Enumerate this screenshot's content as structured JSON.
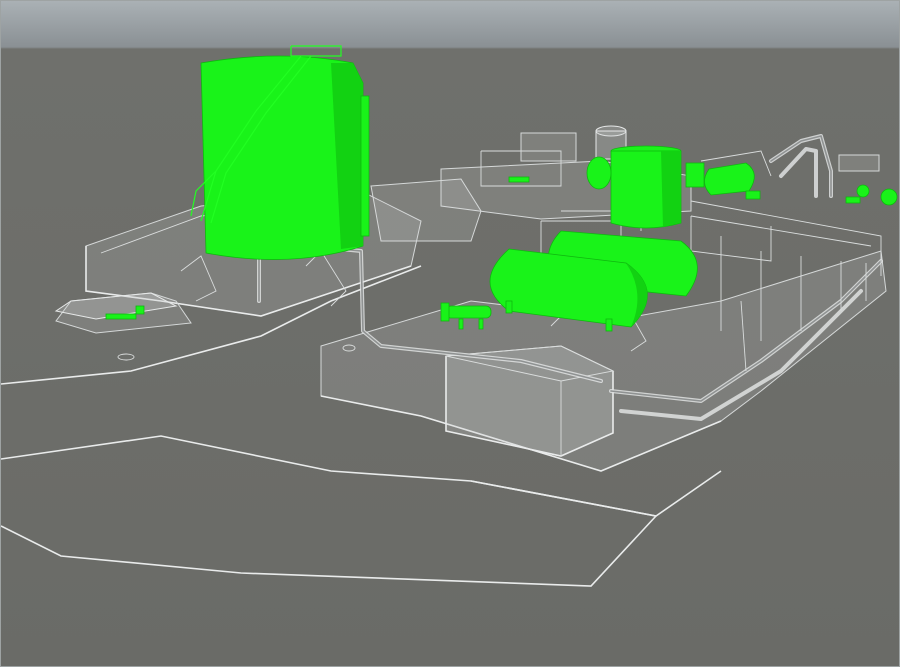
{
  "viewport": {
    "background_color": "#6a6b67",
    "sky_color": "#aab1b5",
    "highlight_color": "#19f319",
    "wireframe_color": "#e9ebeb"
  },
  "equipment": [
    {
      "name": "storage-tank",
      "highlighted": true
    },
    {
      "name": "vertical-vessel",
      "highlighted": true
    },
    {
      "name": "horizontal-drum-1",
      "highlighted": true
    },
    {
      "name": "horizontal-drum-2",
      "highlighted": true
    },
    {
      "name": "heat-exchanger",
      "highlighted": true
    },
    {
      "name": "pump-skid",
      "highlighted": true
    }
  ]
}
